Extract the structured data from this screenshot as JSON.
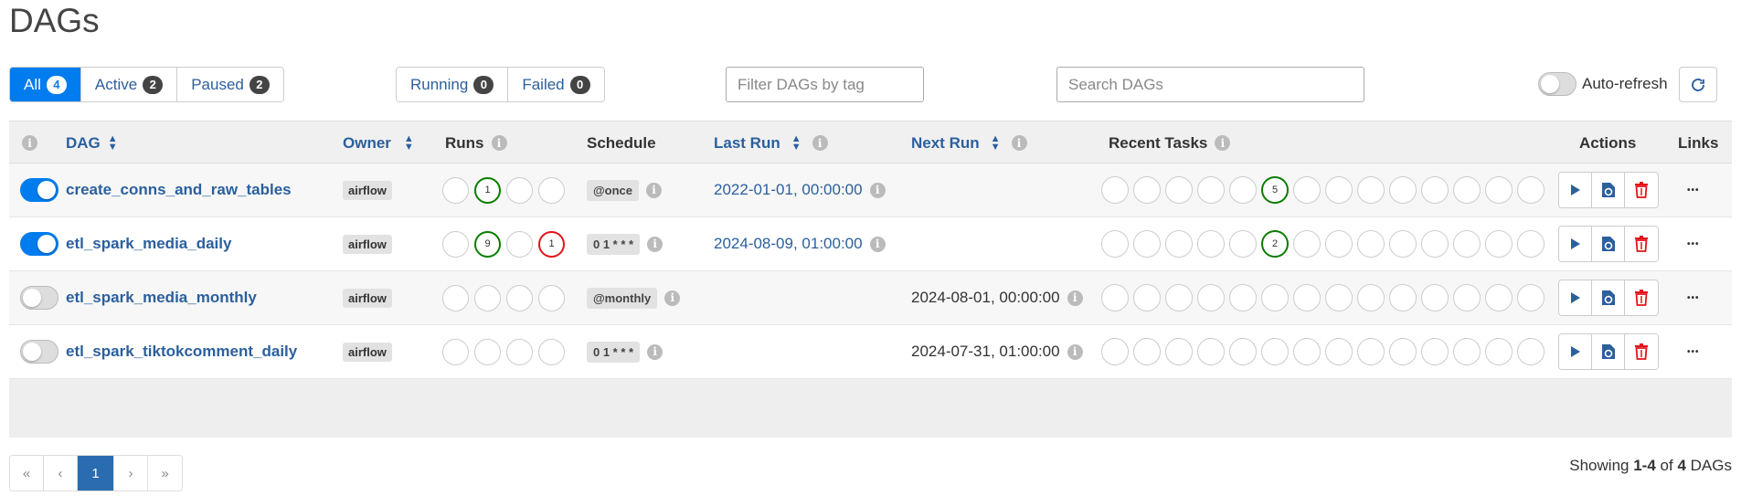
{
  "page_title": "DAGs",
  "status_filters": [
    {
      "label": "All",
      "count": "4"
    },
    {
      "label": "Active",
      "count": "2"
    },
    {
      "label": "Paused",
      "count": "2"
    }
  ],
  "run_filters": [
    {
      "label": "Running",
      "count": "0"
    },
    {
      "label": "Failed",
      "count": "0"
    }
  ],
  "tag_filter_placeholder": "Filter DAGs by tag",
  "search_placeholder": "Search DAGs",
  "auto_refresh_label": "Auto-refresh",
  "columns": {
    "dag": "DAG",
    "owner": "Owner",
    "runs": "Runs",
    "schedule": "Schedule",
    "last_run": "Last Run",
    "next_run": "Next Run",
    "recent_tasks": "Recent Tasks",
    "actions": "Actions",
    "links": "Links"
  },
  "dags": [
    {
      "name": "create_conns_and_raw_tables",
      "active": true,
      "owner": "airflow",
      "runs": [
        "",
        "1",
        "",
        ""
      ],
      "schedule": "@once",
      "last_run": "2022-01-01, 00:00:00",
      "next_run": "",
      "recent_task_index": 5,
      "recent_task_count": "5"
    },
    {
      "name": "etl_spark_media_daily",
      "active": true,
      "owner": "airflow",
      "runs": [
        "",
        "9",
        "",
        "1"
      ],
      "schedule": "0 1 * * *",
      "last_run": "2024-08-09, 01:00:00",
      "next_run": "",
      "recent_task_index": 5,
      "recent_task_count": "2"
    },
    {
      "name": "etl_spark_media_monthly",
      "active": false,
      "owner": "airflow",
      "runs": [
        "",
        "",
        "",
        ""
      ],
      "schedule": "@monthly",
      "last_run": "",
      "next_run": "2024-08-01, 00:00:00",
      "recent_task_index": -1,
      "recent_task_count": ""
    },
    {
      "name": "etl_spark_tiktokcomment_daily",
      "active": false,
      "owner": "airflow",
      "runs": [
        "",
        "",
        "",
        ""
      ],
      "schedule": "0 1 * * *",
      "last_run": "",
      "next_run": "2024-07-31, 01:00:00",
      "recent_task_index": -1,
      "recent_task_count": ""
    }
  ],
  "pagination": {
    "first": "«",
    "prev": "‹",
    "current": "1",
    "next": "›",
    "last": "»"
  },
  "showing": {
    "prefix": "Showing",
    "range": "1-4",
    "of": "of",
    "total": "4",
    "suffix": "DAGs"
  },
  "colors": {
    "primary": "#017cee",
    "link": "#2b5f9e",
    "success": "#0a7d00",
    "failed": "#e3131a",
    "delete": "#e3131a"
  },
  "icons": {
    "info": "info-icon",
    "refresh": "refresh-icon",
    "trigger": "play-icon",
    "reparse": "reparse-file-icon",
    "delete": "trash-icon",
    "links": "more-dots-icon"
  }
}
